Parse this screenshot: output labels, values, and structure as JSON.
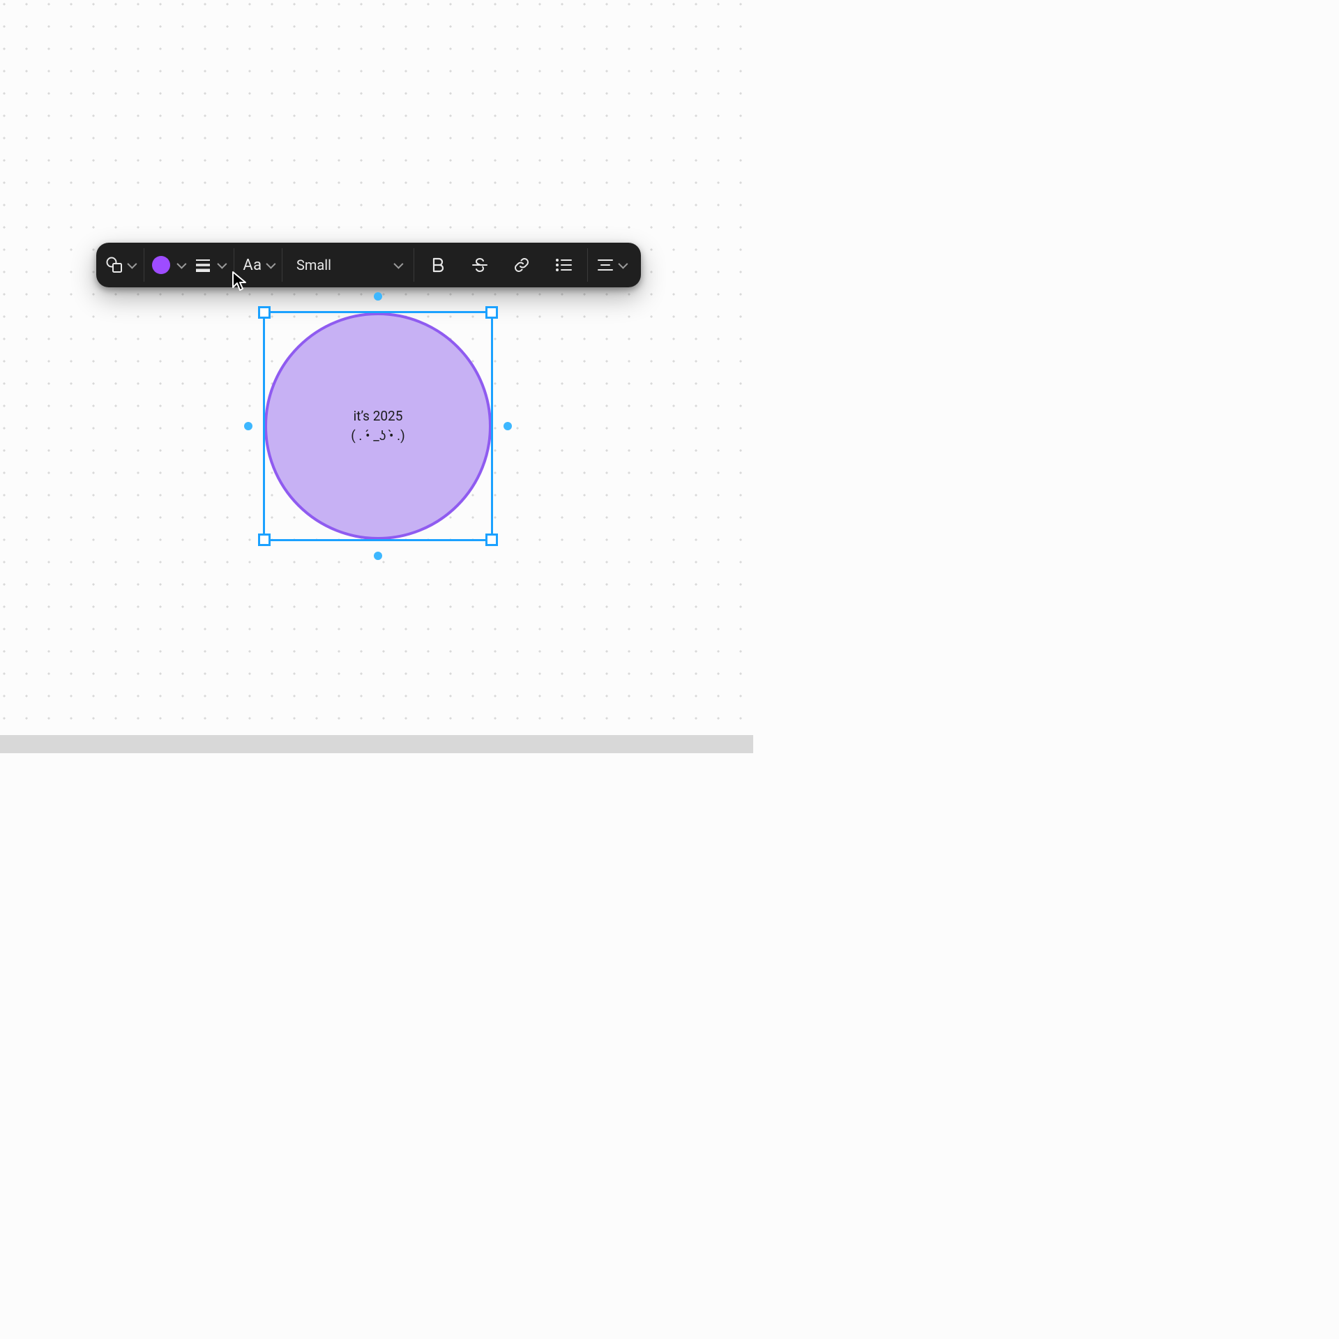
{
  "toolbar": {
    "font_size_selected": "Small",
    "font_label": "Aa",
    "color_swatch": "#9e4cff"
  },
  "shape": {
    "text_line1": "it’s 2025",
    "text_line2": "( . •́ _ʖ •̀ .)",
    "fill": "#c7b1f4",
    "stroke": "#8f5bf0"
  },
  "selection": {
    "color": "#1ba1ff"
  }
}
